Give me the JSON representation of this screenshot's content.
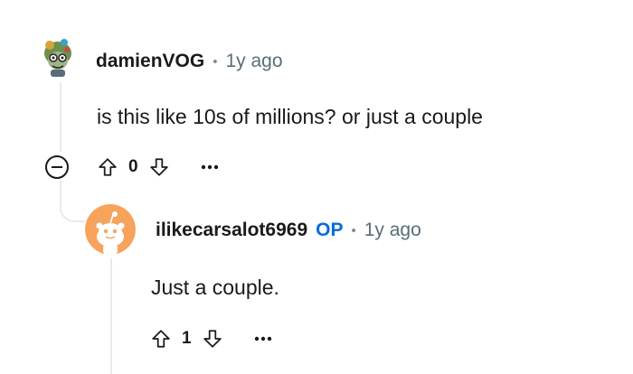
{
  "comments": [
    {
      "username": "damienVOG",
      "separator": "•",
      "time": "1y ago",
      "body": "is this like 10s of millions? or just a couple",
      "score": "0"
    },
    {
      "username": "ilikecarsalot6969",
      "op_badge": "OP",
      "separator": "•",
      "time": "1y ago",
      "body": "Just a couple.",
      "score": "1"
    }
  ],
  "icons": {
    "upvote": "upvote-arrow-icon",
    "downvote": "downvote-arrow-icon",
    "more": "more-options-icon",
    "collapse": "collapse-thread-icon"
  },
  "colors": {
    "op_badge": "#0a6bd8",
    "thread_line": "#e5ebee",
    "meta_text": "#576f76"
  }
}
